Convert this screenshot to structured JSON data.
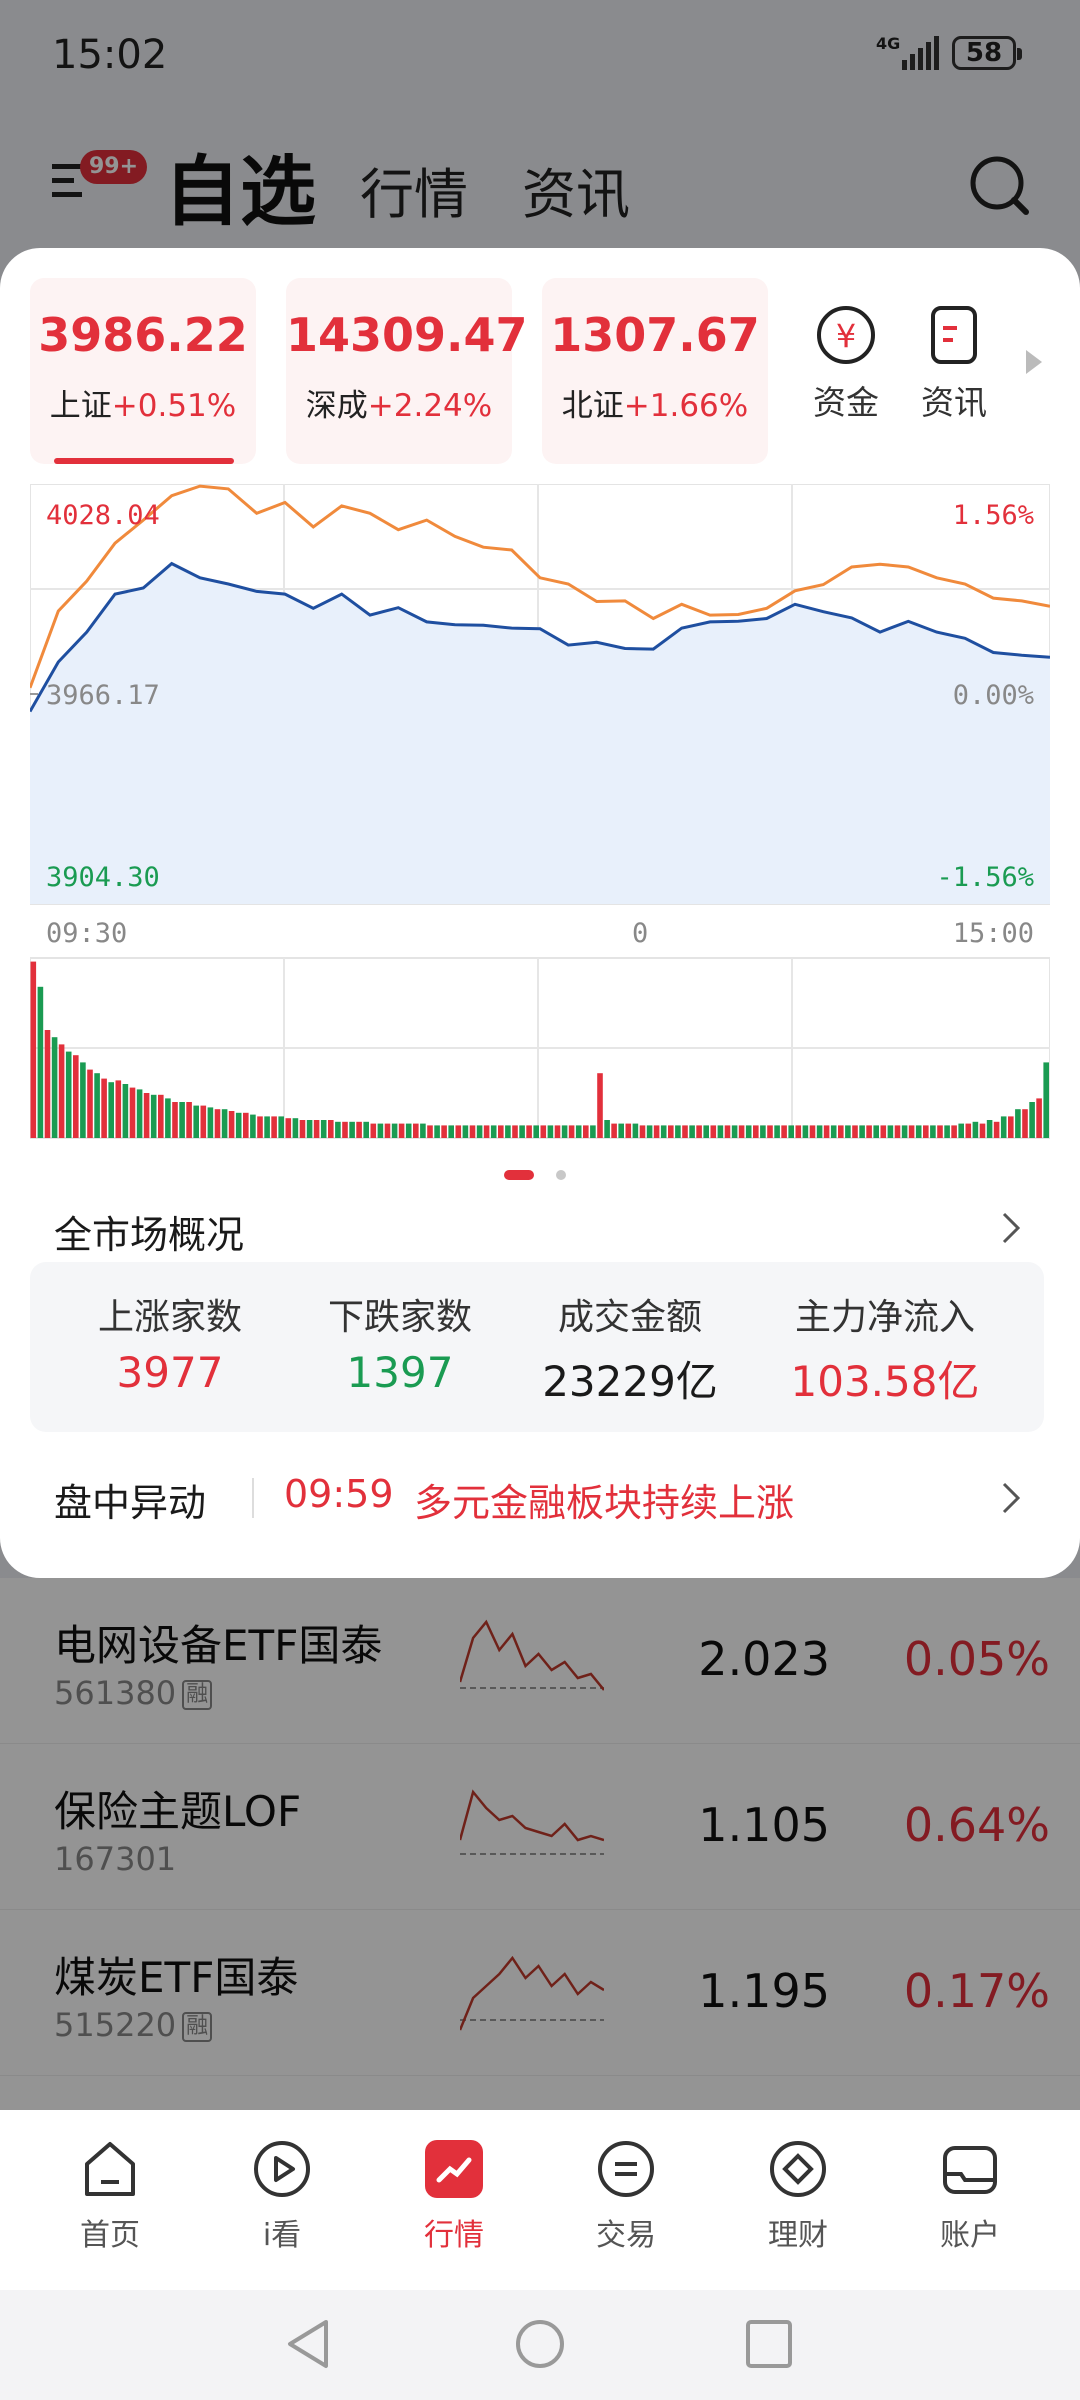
{
  "status": {
    "time": "15:02",
    "network": "4G",
    "battery": "58"
  },
  "header": {
    "badge": "99+",
    "tabs": [
      {
        "label": "自选",
        "active": true
      },
      {
        "label": "行情"
      },
      {
        "label": "资讯"
      }
    ]
  },
  "indices": [
    {
      "value": "3986.22",
      "name": "上证",
      "change": "+0.51%"
    },
    {
      "value": "14309.47",
      "name": "深成",
      "change": "+2.24%"
    },
    {
      "value": "1307.67",
      "name": "北证",
      "change": "+1.66%"
    }
  ],
  "quick_links": [
    {
      "label": "资金",
      "icon": "yuan-circle-icon"
    },
    {
      "label": "资讯",
      "icon": "news-icon"
    }
  ],
  "chart_data": {
    "type": "line",
    "y_left_top": "4028.04",
    "y_left_mid": "3966.17",
    "y_left_bottom": "3904.30",
    "y_right_top": "1.56%",
    "y_right_mid": "0.00%",
    "y_right_bottom": "-1.56%",
    "x_start": "09:30",
    "x_mid": "0",
    "x_end": "15:00",
    "ylim": [
      3904.3,
      4028.04
    ],
    "series": [
      {
        "color": "#f08a3c",
        "values": [
          3968,
          3990,
          4000,
          4010,
          4018,
          4024,
          4028,
          4026,
          4020,
          4022,
          4016,
          4021,
          4020,
          4014,
          4018,
          4012,
          4010,
          4008,
          4001,
          3998,
          3994,
          3993,
          3989,
          3992,
          3990,
          3989,
          3992,
          3996,
          3999,
          4003,
          4005,
          4003,
          4001,
          3998,
          3995,
          3993,
          3992
        ]
      },
      {
        "color": "#1f4fa0",
        "values": [
          3961,
          3975,
          3985,
          3995,
          3998,
          4004,
          4001,
          3998,
          3997,
          3995,
          3992,
          3995,
          3990,
          3991,
          3988,
          3986,
          3987,
          3985,
          3986,
          3980,
          3982,
          3979,
          3980,
          3985,
          3988,
          3987,
          3989,
          3992,
          3991,
          3988,
          3985,
          3987,
          3985,
          3982,
          3979,
          3977,
          3977
        ]
      }
    ],
    "volume_red": [
      0.98,
      0.6,
      0.52,
      0.46,
      0.38,
      0.33,
      0.32,
      0.28,
      0.25,
      0.24,
      0.2,
      0.2,
      0.18,
      0.16,
      0.15,
      0.14,
      0.12,
      0.12,
      0.11,
      0.1,
      0.1,
      0.1,
      0.09,
      0.09,
      0.08,
      0.08,
      0.08,
      0.08,
      0.07,
      0.07,
      0.07,
      0.07,
      0.07,
      0.07,
      0.07,
      0.07,
      0.07,
      0.07,
      0.07,
      0.07,
      0.36,
      0.08,
      0.08,
      0.07,
      0.07,
      0.07,
      0.07,
      0.07,
      0.07,
      0.07,
      0.07,
      0.07,
      0.07,
      0.07,
      0.07,
      0.07,
      0.07,
      0.07,
      0.07,
      0.07,
      0.07,
      0.07,
      0.07,
      0.07,
      0.07,
      0.07,
      0.08,
      0.08,
      0.09,
      0.12,
      0.16,
      0.22
    ],
    "volume_green": [
      0.84,
      0.56,
      0.48,
      0.42,
      0.36,
      0.31,
      0.3,
      0.27,
      0.24,
      0.22,
      0.2,
      0.18,
      0.17,
      0.16,
      0.14,
      0.13,
      0.12,
      0.12,
      0.11,
      0.1,
      0.1,
      0.09,
      0.09,
      0.09,
      0.08,
      0.08,
      0.08,
      0.08,
      0.07,
      0.07,
      0.07,
      0.07,
      0.07,
      0.07,
      0.07,
      0.07,
      0.07,
      0.07,
      0.07,
      0.07,
      0.1,
      0.08,
      0.08,
      0.07,
      0.07,
      0.07,
      0.07,
      0.07,
      0.07,
      0.07,
      0.07,
      0.07,
      0.07,
      0.07,
      0.07,
      0.07,
      0.07,
      0.07,
      0.07,
      0.07,
      0.07,
      0.07,
      0.07,
      0.07,
      0.07,
      0.08,
      0.09,
      0.1,
      0.12,
      0.16,
      0.2,
      0.42
    ]
  },
  "overview": {
    "title": "全市场概况",
    "stats": [
      {
        "label": "上涨家数",
        "value": "3977",
        "color": "#e2303b"
      },
      {
        "label": "下跌家数",
        "value": "1397",
        "color": "#1a9b52"
      },
      {
        "label": "成交金额",
        "value": "23229亿",
        "color": "#1a1a1a"
      },
      {
        "label": "主力净流入",
        "value": "103.58亿",
        "color": "#e2303b"
      }
    ]
  },
  "alert": {
    "label": "盘中异动",
    "time": "09:59",
    "text": "多元金融板块持续上涨"
  },
  "watchlist": [
    {
      "name": "电网设备ETF国泰",
      "code": "561380",
      "margin": "融",
      "price": "2.023",
      "change": "0.05%",
      "spark": [
        0.2,
        0.75,
        0.95,
        0.6,
        0.8,
        0.4,
        0.55,
        0.35,
        0.45,
        0.25,
        0.3,
        0.1
      ]
    },
    {
      "name": "保险主题LOF",
      "code": "167301",
      "margin": "",
      "price": "1.105",
      "change": "0.64%",
      "spark": [
        0.3,
        0.9,
        0.7,
        0.55,
        0.6,
        0.45,
        0.4,
        0.35,
        0.5,
        0.3,
        0.35,
        0.3
      ]
    },
    {
      "name": "煤炭ETF国泰",
      "code": "515220",
      "margin": "融",
      "price": "1.195",
      "change": "0.17%",
      "spark": [
        0.0,
        0.4,
        0.55,
        0.7,
        0.9,
        0.65,
        0.8,
        0.55,
        0.7,
        0.45,
        0.6,
        0.5
      ]
    }
  ],
  "bottom_nav": [
    {
      "label": "首页",
      "icon": "home-icon"
    },
    {
      "label": "i看",
      "icon": "play-icon"
    },
    {
      "label": "行情",
      "icon": "market-icon",
      "active": true
    },
    {
      "label": "交易",
      "icon": "trade-icon"
    },
    {
      "label": "理财",
      "icon": "wealth-icon"
    },
    {
      "label": "账户",
      "icon": "account-icon"
    }
  ]
}
